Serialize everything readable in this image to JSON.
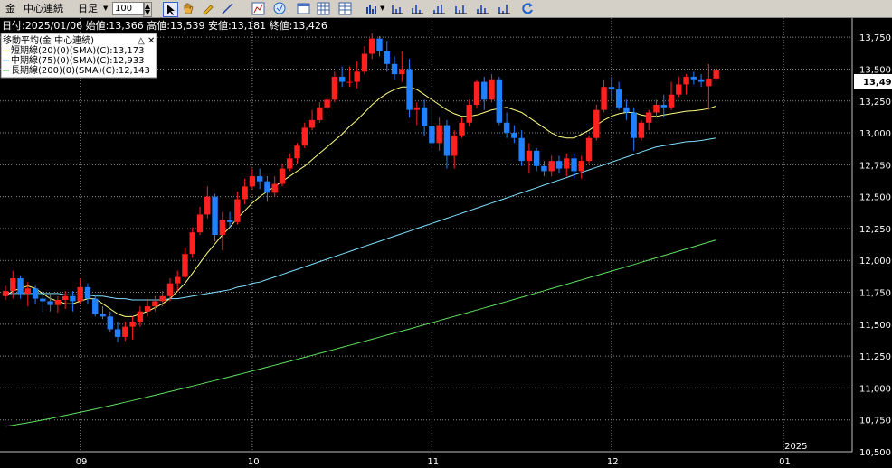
{
  "toolbar": {
    "symbol": "金",
    "contract": "中心連続",
    "period": "日足",
    "count": "100",
    "icons": [
      "cursor-icon",
      "hand-icon",
      "pencil-icon",
      "line-tool-icon",
      "fib-icon",
      "zoom-icon",
      "window-icon",
      "grid-icon",
      "table-icon",
      "bar-chart-icon",
      "indicator-icon-1",
      "indicator-icon-2",
      "indicator-icon-3",
      "indicator-icon-4",
      "indicator-icon-5",
      "refresh-icon"
    ]
  },
  "info_line": "日付:2025/01/06 始値:13,366 高値:13,539 安値:13,181 終値:13,426",
  "legend": {
    "title": "移動平均(金 中心連続)",
    "lines": [
      {
        "label": "短期線(20)(0)(SMA)(C):13,173",
        "color": "#ffff80"
      },
      {
        "label": "中期線(75)(0)(SMA)(C):12,933",
        "color": "#80e0ff"
      },
      {
        "label": "長期線(200)(0)(SMA)(C):12,143",
        "color": "#60e060"
      }
    ]
  },
  "colors": {
    "up": "#ff2020",
    "down": "#2080ff",
    "background": "#000000",
    "grid": "#b0b0b0"
  },
  "chart_data": {
    "type": "candlestick",
    "y_ticks": [
      "13,750",
      "13,500",
      "13,250",
      "13,000",
      "12,750",
      "12,500",
      "12,250",
      "12,000",
      "11,750",
      "11,500",
      "11,250",
      "11,000",
      "10,750",
      "10,500"
    ],
    "ylim": [
      10500,
      13900
    ],
    "x_ticks": [
      {
        "label": "09",
        "index": 10
      },
      {
        "label": "10",
        "index": 33
      },
      {
        "label": "11",
        "index": 57
      },
      {
        "label": "12",
        "index": 81
      },
      {
        "label": "01",
        "index": 104
      }
    ],
    "year_label": {
      "label": "2025",
      "index": 104
    },
    "current_price": "13,491",
    "candles": [
      [
        11720,
        11800,
        11690,
        11760
      ],
      [
        11760,
        11920,
        11700,
        11860
      ],
      [
        11860,
        11880,
        11700,
        11740
      ],
      [
        11740,
        11830,
        11640,
        11780
      ],
      [
        11780,
        11800,
        11660,
        11700
      ],
      [
        11700,
        11760,
        11600,
        11680
      ],
      [
        11680,
        11740,
        11600,
        11650
      ],
      [
        11650,
        11720,
        11590,
        11690
      ],
      [
        11690,
        11760,
        11620,
        11720
      ],
      [
        11720,
        11760,
        11600,
        11680
      ],
      [
        11680,
        11860,
        11660,
        11790
      ],
      [
        11790,
        11820,
        11660,
        11700
      ],
      [
        11700,
        11720,
        11560,
        11580
      ],
      [
        11580,
        11640,
        11540,
        11560
      ],
      [
        11560,
        11600,
        11440,
        11460
      ],
      [
        11460,
        11520,
        11360,
        11400
      ],
      [
        11400,
        11520,
        11370,
        11480
      ],
      [
        11480,
        11560,
        11380,
        11520
      ],
      [
        11520,
        11640,
        11480,
        11600
      ],
      [
        11600,
        11700,
        11560,
        11640
      ],
      [
        11640,
        11720,
        11600,
        11680
      ],
      [
        11680,
        11760,
        11640,
        11720
      ],
      [
        11720,
        11860,
        11680,
        11820
      ],
      [
        11820,
        11920,
        11760,
        11870
      ],
      [
        11870,
        12100,
        11860,
        12050
      ],
      [
        12050,
        12260,
        12020,
        12220
      ],
      [
        12220,
        12420,
        12200,
        12360
      ],
      [
        12360,
        12580,
        12330,
        12500
      ],
      [
        12500,
        12520,
        12150,
        12200
      ],
      [
        12200,
        12380,
        12080,
        12320
      ],
      [
        12320,
        12380,
        12260,
        12300
      ],
      [
        12300,
        12540,
        12280,
        12480
      ],
      [
        12480,
        12640,
        12440,
        12580
      ],
      [
        12580,
        12720,
        12560,
        12660
      ],
      [
        12660,
        12720,
        12560,
        12620
      ],
      [
        12620,
        12660,
        12460,
        12530
      ],
      [
        12530,
        12660,
        12500,
        12600
      ],
      [
        12600,
        12760,
        12580,
        12720
      ],
      [
        12720,
        12840,
        12700,
        12800
      ],
      [
        12800,
        12920,
        12760,
        12900
      ],
      [
        12900,
        13080,
        12880,
        13040
      ],
      [
        13040,
        13180,
        13020,
        13100
      ],
      [
        13100,
        13240,
        13080,
        13200
      ],
      [
        13200,
        13300,
        13180,
        13260
      ],
      [
        13260,
        13480,
        13240,
        13440
      ],
      [
        13440,
        13520,
        13360,
        13400
      ],
      [
        13400,
        13520,
        13360,
        13400
      ],
      [
        13400,
        13560,
        13350,
        13480
      ],
      [
        13480,
        13680,
        13460,
        13620
      ],
      [
        13620,
        13780,
        13580,
        13740
      ],
      [
        13740,
        13760,
        13600,
        13640
      ],
      [
        13640,
        13720,
        13480,
        13540
      ],
      [
        13540,
        13600,
        13420,
        13460
      ],
      [
        13460,
        13640,
        13400,
        13500
      ],
      [
        13500,
        13580,
        13120,
        13180
      ],
      [
        13180,
        13240,
        13060,
        13200
      ],
      [
        13200,
        13260,
        12980,
        13050
      ],
      [
        13050,
        13220,
        12880,
        12920
      ],
      [
        12920,
        13120,
        12860,
        13060
      ],
      [
        13060,
        13100,
        12720,
        12820
      ],
      [
        12820,
        13020,
        12720,
        12980
      ],
      [
        12980,
        13120,
        12960,
        13080
      ],
      [
        13080,
        13260,
        13050,
        13220
      ],
      [
        13220,
        13420,
        13190,
        13400
      ],
      [
        13400,
        13440,
        13180,
        13260
      ],
      [
        13260,
        13460,
        13240,
        13420
      ],
      [
        13420,
        13440,
        13060,
        13080
      ],
      [
        13080,
        13160,
        12960,
        13000
      ],
      [
        13000,
        13060,
        12920,
        12960
      ],
      [
        12960,
        13020,
        12740,
        12780
      ],
      [
        12780,
        12920,
        12680,
        12860
      ],
      [
        12860,
        12880,
        12700,
        12740
      ],
      [
        12740,
        12780,
        12660,
        12700
      ],
      [
        12700,
        12820,
        12660,
        12780
      ],
      [
        12780,
        12820,
        12680,
        12720
      ],
      [
        12720,
        12840,
        12660,
        12800
      ],
      [
        12800,
        12840,
        12640,
        12700
      ],
      [
        12700,
        12820,
        12640,
        12780
      ],
      [
        12780,
        12980,
        12760,
        12960
      ],
      [
        12960,
        13220,
        12940,
        13180
      ],
      [
        13180,
        13420,
        13160,
        13360
      ],
      [
        13360,
        13440,
        13260,
        13340
      ],
      [
        13340,
        13400,
        13180,
        13200
      ],
      [
        13200,
        13260,
        13100,
        13160
      ],
      [
        13160,
        13200,
        12860,
        12960
      ],
      [
        12960,
        13100,
        12940,
        13080
      ],
      [
        13080,
        13180,
        13020,
        13160
      ],
      [
        13160,
        13260,
        13120,
        13220
      ],
      [
        13220,
        13300,
        13120,
        13200
      ],
      [
        13200,
        13400,
        13180,
        13300
      ],
      [
        13300,
        13440,
        13280,
        13380
      ],
      [
        13380,
        13460,
        13300,
        13440
      ],
      [
        13440,
        13480,
        13380,
        13420
      ],
      [
        13420,
        13460,
        13360,
        13400
      ],
      [
        13366,
        13539,
        13181,
        13426
      ],
      [
        13426,
        13520,
        13400,
        13491
      ]
    ],
    "series": [
      {
        "name": "短期線(20)(0)(SMA)(C)",
        "values": [
          11720,
          11760,
          11780,
          11800,
          11780,
          11740,
          11700,
          11680,
          11660,
          11660,
          11680,
          11700,
          11700,
          11660,
          11620,
          11580,
          11560,
          11560,
          11580,
          11600,
          11630,
          11660,
          11700,
          11760,
          11820,
          11900,
          11980,
          12060,
          12130,
          12200,
          12260,
          12330,
          12390,
          12450,
          12500,
          12540,
          12580,
          12620,
          12660,
          12700,
          12740,
          12790,
          12840,
          12890,
          12940,
          12990,
          13050,
          13100,
          13160,
          13220,
          13270,
          13310,
          13340,
          13360,
          13360,
          13340,
          13300,
          13260,
          13220,
          13180,
          13150,
          13130,
          13130,
          13140,
          13160,
          13180,
          13190,
          13200,
          13180,
          13160,
          13120,
          13080,
          13040,
          13000,
          12970,
          12960,
          12960,
          12990,
          13020,
          13060,
          13100,
          13130,
          13150,
          13160,
          13160,
          13140,
          13130,
          13130,
          13140,
          13150,
          13160,
          13170,
          13173,
          13180,
          13190,
          13210
        ]
      },
      {
        "name": "中期線(75)(0)(SMA)(C)",
        "values": [
          11740,
          11740,
          11740,
          11740,
          11740,
          11740,
          11740,
          11740,
          11730,
          11730,
          11730,
          11730,
          11720,
          11720,
          11710,
          11700,
          11700,
          11690,
          11690,
          11690,
          11690,
          11690,
          11700,
          11700,
          11710,
          11720,
          11730,
          11740,
          11750,
          11760,
          11770,
          11790,
          11800,
          11820,
          11830,
          11850,
          11870,
          11890,
          11910,
          11930,
          11950,
          11970,
          11990,
          12010,
          12030,
          12050,
          12070,
          12090,
          12110,
          12130,
          12150,
          12170,
          12190,
          12210,
          12230,
          12250,
          12270,
          12290,
          12310,
          12330,
          12350,
          12370,
          12390,
          12410,
          12430,
          12450,
          12470,
          12490,
          12510,
          12530,
          12550,
          12570,
          12590,
          12610,
          12630,
          12650,
          12670,
          12690,
          12710,
          12730,
          12750,
          12770,
          12790,
          12810,
          12830,
          12850,
          12870,
          12890,
          12900,
          12910,
          12920,
          12930,
          12933,
          12940,
          12950,
          12960
        ]
      }
    ]
  }
}
